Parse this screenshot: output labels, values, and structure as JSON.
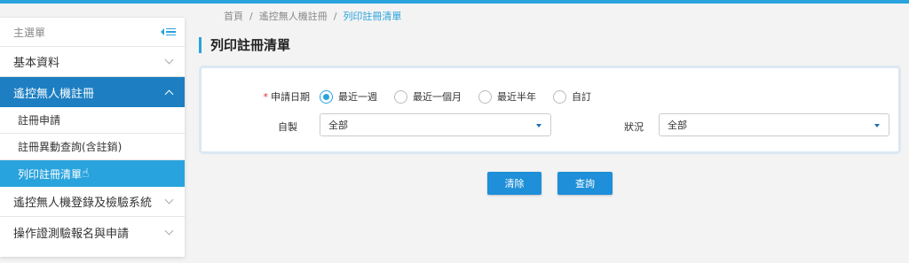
{
  "sidebar": {
    "title": "主選單",
    "collapse_icon": "collapse-menu-icon",
    "items": [
      {
        "label": "基本資料"
      },
      {
        "label": "遙控無人機註冊",
        "children": [
          {
            "label": "註冊申請"
          },
          {
            "label": "註冊異動查詢(含註銷)"
          },
          {
            "label": "列印註冊清單"
          }
        ]
      },
      {
        "label": "遙控無人機登錄及檢驗系統"
      },
      {
        "label": "操作證測驗報名與申請"
      }
    ]
  },
  "breadcrumb": [
    "首頁",
    "遙控無人機註冊",
    "列印註冊清單"
  ],
  "breadcrumb_sep": "/",
  "page": {
    "title": "列印註冊清單"
  },
  "form": {
    "required_mark": "*",
    "date_label": "申請日期",
    "date_options": [
      "最近一週",
      "最近一個月",
      "最近半年",
      "自訂"
    ],
    "date_selected": "最近一週",
    "self_made_label": "自製",
    "self_made_value": "全部",
    "status_label": "狀況",
    "status_value": "全部"
  },
  "buttons": {
    "clear": "清除",
    "search": "查詢"
  },
  "colors": {
    "accent": "#29a3dd",
    "active_menu": "#1d7fc2",
    "button": "#1e8fd8"
  }
}
